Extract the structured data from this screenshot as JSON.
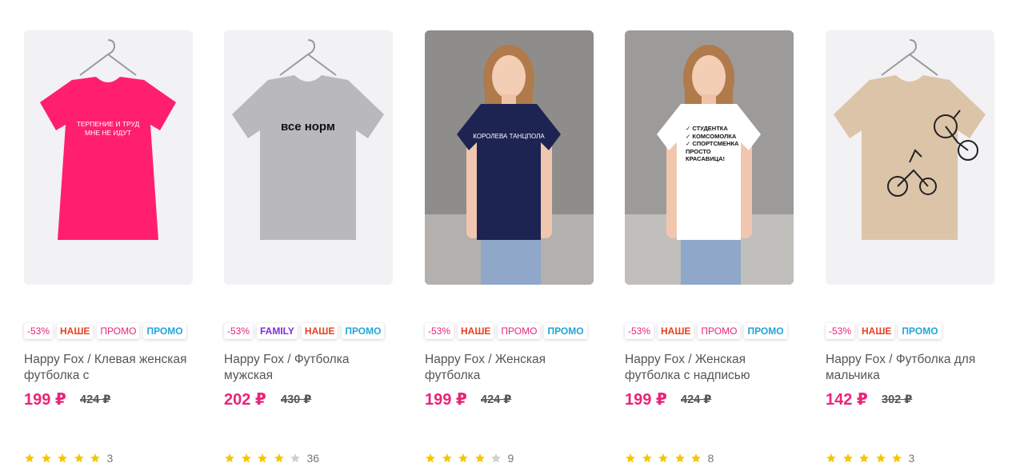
{
  "products": [
    {
      "shirt_color": "#ff1f6e",
      "print_text": "ТЕРПЕНИЕ И ТРУД\nМНЕ НЕ ИДУТ",
      "badges": [
        {
          "kind": "disc",
          "label": "-53%"
        },
        {
          "kind": "nashe",
          "label": "НАШЕ"
        },
        {
          "kind": "promo",
          "label": "ПРОМО"
        },
        {
          "kind": "promo2",
          "label": "ПРОМО"
        }
      ],
      "title": "Happy Fox / Клевая женская футболка с",
      "price": "199 ₽",
      "old_price": "424 ₽",
      "rating": 5,
      "reviews": "3"
    },
    {
      "shirt_color": "#b9b9bb",
      "print_text": "все норм",
      "badges": [
        {
          "kind": "disc",
          "label": "-53%"
        },
        {
          "kind": "family",
          "label": "FAMILY"
        },
        {
          "kind": "nashe",
          "label": "НАШЕ"
        },
        {
          "kind": "promo2",
          "label": "ПРОМО"
        }
      ],
      "title": "Happy Fox / Футболка мужская",
      "price": "202 ₽",
      "old_price": "430 ₽",
      "rating": 4,
      "reviews": "36"
    },
    {
      "shirt_color": "#1d2452",
      "print_text": "КОРОЛЕВА ТАНЦПОЛА",
      "badges": [
        {
          "kind": "disc",
          "label": "-53%"
        },
        {
          "kind": "nashe",
          "label": "НАШЕ"
        },
        {
          "kind": "promo",
          "label": "ПРОМО"
        },
        {
          "kind": "promo2",
          "label": "ПРОМО"
        }
      ],
      "title": "Happy Fox / Женская футболка",
      "price": "199 ₽",
      "old_price": "424 ₽",
      "rating": 4,
      "reviews": "9"
    },
    {
      "shirt_color": "#ffffff",
      "print_text": "✓ СТУДЕНТКА\n✓ КОМСОМОЛКА\n✓ СПОРТСМЕНКА\nПРОСТО\nКРАСАВИЦА!",
      "badges": [
        {
          "kind": "disc",
          "label": "-53%"
        },
        {
          "kind": "nashe",
          "label": "НАШЕ"
        },
        {
          "kind": "promo",
          "label": "ПРОМО"
        },
        {
          "kind": "promo2",
          "label": "ПРОМО"
        }
      ],
      "title": "Happy Fox / Женская футболка с надписью",
      "price": "199 ₽",
      "old_price": "424 ₽",
      "rating": 5,
      "reviews": "8"
    },
    {
      "shirt_color": "#dcc4a8",
      "print_text": "",
      "badges": [
        {
          "kind": "disc",
          "label": "-53%"
        },
        {
          "kind": "nashe",
          "label": "НАШЕ"
        },
        {
          "kind": "promo2",
          "label": "ПРОМО"
        }
      ],
      "title": "Happy Fox / Футболка для мальчика",
      "price": "142 ₽",
      "old_price": "302 ₽",
      "rating": 5,
      "reviews": "3"
    }
  ],
  "colors": {
    "price": "#e8257b",
    "star_on": "#f7c600",
    "star_off": "#cfcfcf"
  }
}
